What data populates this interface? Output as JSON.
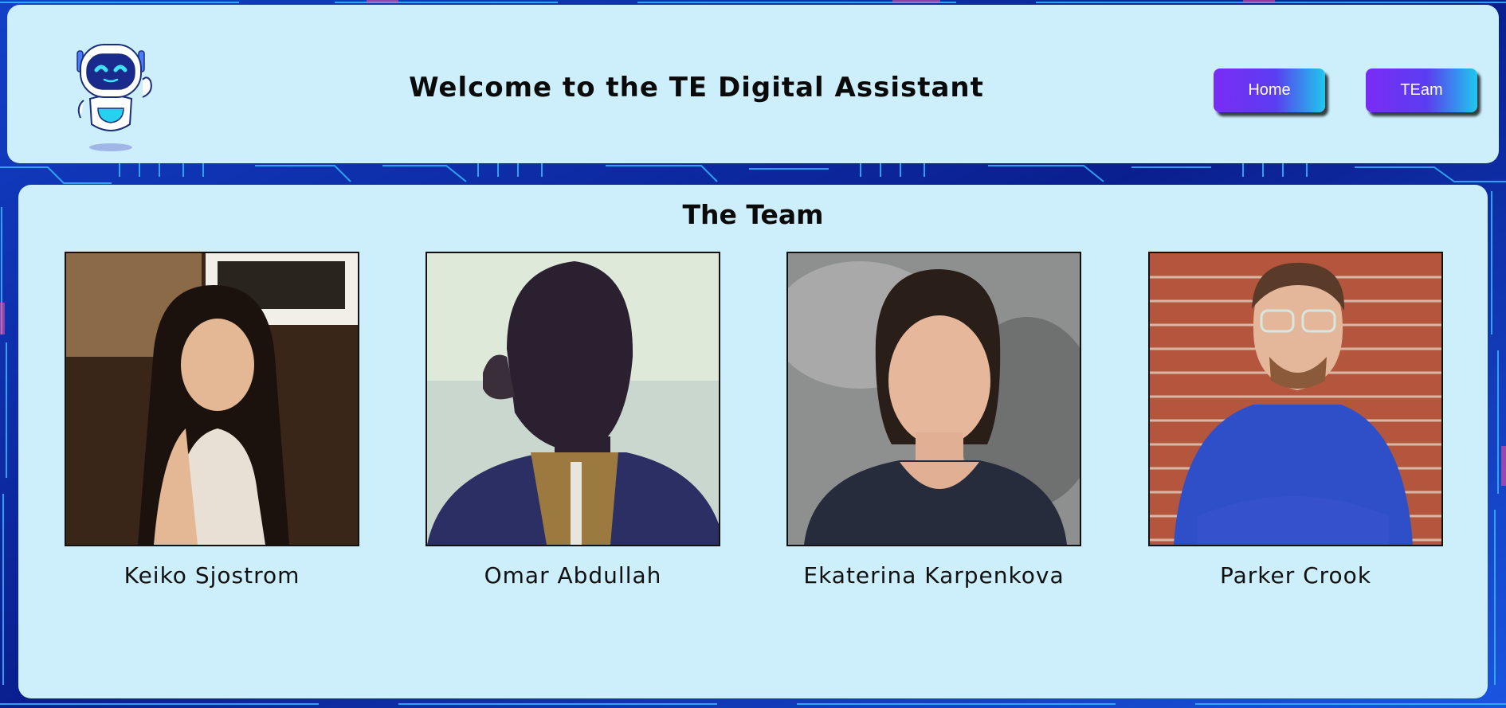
{
  "header": {
    "logo_icon": "robot-mascot-icon",
    "title": "Welcome to the TE Digital Assistant",
    "nav": [
      {
        "label": "Home"
      },
      {
        "label": "TEam"
      }
    ]
  },
  "team": {
    "heading": "The Team",
    "members": [
      {
        "name": "Keiko Sjostrom"
      },
      {
        "name": "Omar Abdullah"
      },
      {
        "name": "Ekaterina Karpenkova"
      },
      {
        "name": "Parker Crook"
      }
    ]
  },
  "colors": {
    "panel_bg": "#cdeffb",
    "page_bg": "#0a2a8a",
    "button_gradient_start": "#7a2cf5",
    "button_gradient_end": "#1fc8ec"
  }
}
